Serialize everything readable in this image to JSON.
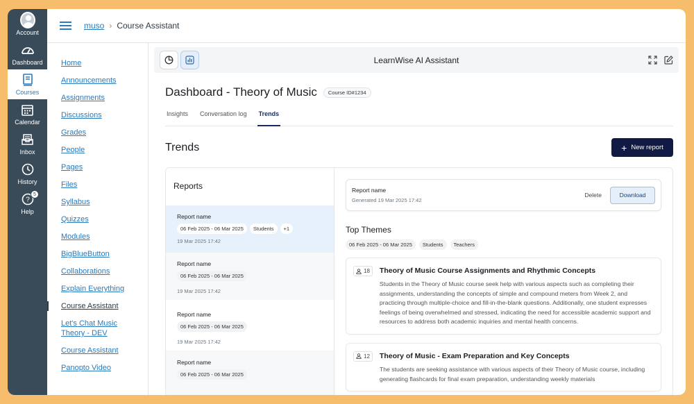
{
  "global_nav": [
    {
      "label": "Account",
      "icon": "account-avatar-icon"
    },
    {
      "label": "Dashboard",
      "icon": "dashboard-gauge-icon"
    },
    {
      "label": "Courses",
      "icon": "courses-book-icon",
      "active": true
    },
    {
      "label": "Calendar",
      "icon": "calendar-icon"
    },
    {
      "label": "Inbox",
      "icon": "inbox-icon"
    },
    {
      "label": "History",
      "icon": "history-clock-icon"
    },
    {
      "label": "Help",
      "icon": "help-icon",
      "badge": "5"
    }
  ],
  "breadcrumb": {
    "course": "muso",
    "current": "Course Assistant"
  },
  "course_nav": [
    "Home",
    "Announcements",
    "Assignments",
    "Discussions",
    "Grades",
    "People",
    "Pages",
    "Files",
    "Syllabus",
    "Quizzes",
    "Modules",
    "BigBlueButton",
    "Collaborations",
    "Explain Everything",
    "Course Assistant",
    "Let's Chat Music Theory - DEV",
    "Course Assistant",
    "Panopto Video"
  ],
  "course_nav_active_index": 14,
  "assistant": {
    "title": "LearnWise AI Assistant",
    "dashboard_title": "Dashboard - Theory of Music",
    "course_id": "Course ID#1234",
    "tabs": [
      "Insights",
      "Conversation log",
      "Trends"
    ],
    "active_tab": "Trends",
    "section_title": "Trends",
    "new_report_label": "New report",
    "reports_heading": "Reports",
    "reports": [
      {
        "name": "Report name",
        "range": "06 Feb 2025 - 06 Mar 2025",
        "tags": [
          "Students",
          "+1"
        ],
        "date": "19 Mar 2025 17:42"
      },
      {
        "name": "Report name",
        "range": "06 Feb 2025 - 06 Mar 2025",
        "tags": [],
        "date": "19 Mar 2025 17:42"
      },
      {
        "name": "Report name",
        "range": "06 Feb 2025 - 06 Mar 2025",
        "tags": [],
        "date": "19 Mar 2025 17:42"
      },
      {
        "name": "Report name",
        "range": "06 Feb 2025 - 06 Mar 2025",
        "tags": [],
        "date": ""
      }
    ],
    "detail": {
      "name": "Report name",
      "generated": "Generated 19 Mar 2025 17:42",
      "delete_label": "Delete",
      "download_label": "Download",
      "top_themes_heading": "Top Themes",
      "filter_tags": [
        "06 Feb 2025 - 06 Mar 2025",
        "Students",
        "Teachers"
      ],
      "themes": [
        {
          "count": "18",
          "title": "Theory of Music Course Assignments and Rhythmic Concepts",
          "text": "Students in the Theory of Music course seek help with various aspects such as completing their assignments, understanding the concepts of simple and compound meters from Week 2, and practicing through multiple-choice and fill-in-the-blank questions. Additionally, one student expresses feelings of being overwhelmed and stressed, indicating the need for accessible academic support and resources to address both academic inquiries and mental health concerns."
        },
        {
          "count": "12",
          "title": "Theory of Music - Exam Preparation and Key Concepts",
          "text": "The students are seeking assistance with various aspects of their Theory of Music course, including generating flashcards for final exam preparation, understanding weekly materials"
        }
      ]
    }
  }
}
